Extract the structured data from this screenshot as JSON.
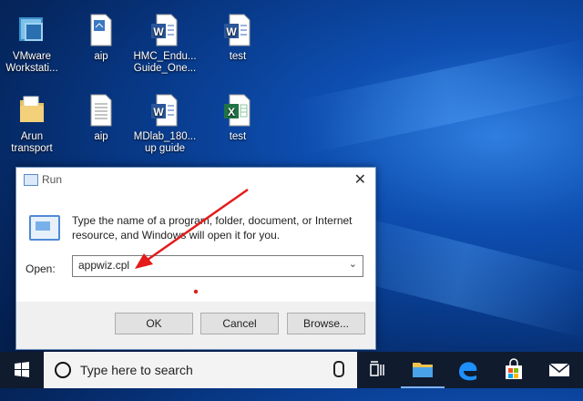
{
  "desktop": {
    "icons": [
      {
        "label": "VMware Workstati...",
        "type": "vmware"
      },
      {
        "label": "aip",
        "type": "doc"
      },
      {
        "label": "HMC_Endu... Guide_One...",
        "type": "word"
      },
      {
        "label": "test",
        "type": "word"
      },
      {
        "label": "Arun transport",
        "type": "folder"
      },
      {
        "label": "aip",
        "type": "doc"
      },
      {
        "label": "MDlab_180... up guide",
        "type": "word"
      },
      {
        "label": "test",
        "type": "excel"
      }
    ]
  },
  "run_dialog": {
    "title": "Run",
    "close_glyph": "✕",
    "description": "Type the name of a program, folder, document, or Internet resource, and Windows will open it for you.",
    "open_label": "Open:",
    "open_value": "appwiz.cpl",
    "ok_label": "OK",
    "cancel_label": "Cancel",
    "browse_label": "Browse..."
  },
  "taskbar": {
    "search_placeholder": "Type here to search",
    "icons": [
      "start-icon",
      "task-view-icon",
      "file-explorer-icon",
      "edge-icon",
      "store-icon",
      "mail-icon"
    ]
  },
  "annotation": {
    "arrow_color": "#e31b1b"
  }
}
